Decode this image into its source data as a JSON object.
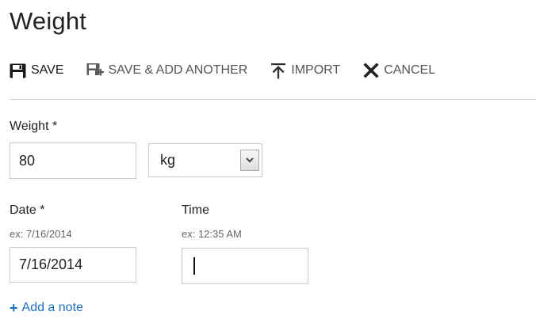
{
  "page": {
    "title": "Weight"
  },
  "toolbar": {
    "save_label": "SAVE",
    "save_icon": "floppy-disk-icon",
    "save_add_label": "SAVE & ADD ANOTHER",
    "save_add_icon": "save-add-icon",
    "import_label": "IMPORT",
    "import_icon": "upload-arrow-icon",
    "cancel_label": "CANCEL",
    "cancel_icon": "close-x-icon"
  },
  "form": {
    "weight": {
      "label": "Weight *",
      "value": "80",
      "unit_selected": "kg"
    },
    "date": {
      "label": "Date *",
      "hint": "ex: 7/16/2014",
      "value": "7/16/2014"
    },
    "time": {
      "label": "Time",
      "hint": "ex: 12:35 AM",
      "value": ""
    },
    "add_note": {
      "plus": "+",
      "label": "Add a note"
    }
  },
  "colors": {
    "link": "#1e6fc4",
    "text": "#222222",
    "muted": "#555555",
    "border": "#c9c9c9"
  }
}
